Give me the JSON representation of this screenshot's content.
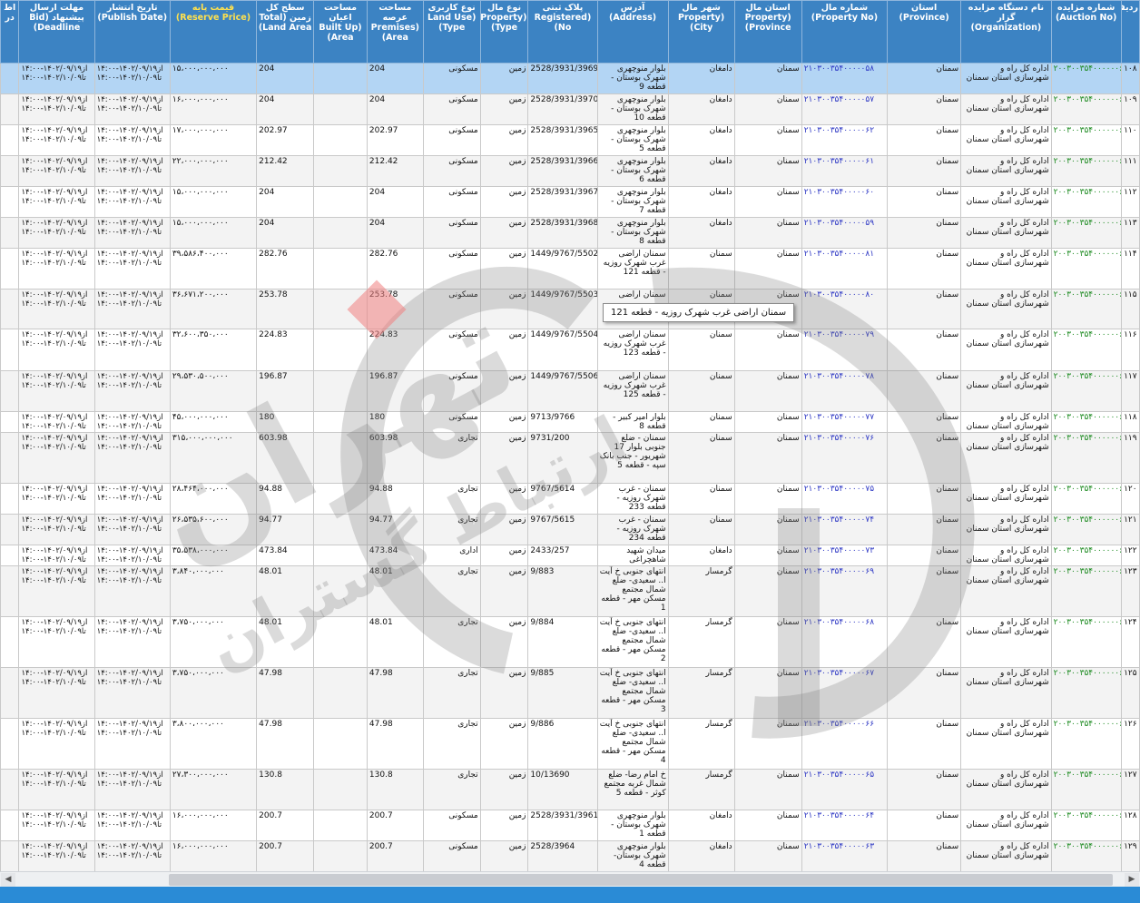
{
  "colors": {
    "header_bg": "#3c83c3",
    "selected_row": "#b3d5f4",
    "link_blue": "#2d37c4",
    "auction_green": "#1c8a20",
    "footer_bar": "#2a8bd6"
  },
  "headers": {
    "row": "ردیف",
    "auction_no": "شماره مزایده (Auction No)",
    "organization": "نام دستگاه مزایده گزار (Organization)",
    "province": "استان (Province)",
    "property_no": "شماره مال (Property No)",
    "property_province": "استان مال (Property Province)",
    "property_city": "شهر مال (Property City)",
    "address": "آدرس (Address)",
    "registered_no": "پلاک ثبتی (Registered No)",
    "property_type": "نوع مال (Property Type)",
    "land_use": "نوع کاربری (Land Use Type)",
    "premises_area": "مساحت عرصه (Premises Area)",
    "built_up_area": "مساحت اعیان (Built Up Area)",
    "total_land": "سطح کل زمین (Total Land Area)",
    "reserve_price": "قیمت پایه (Reserve Price)",
    "publish_date": "تاریخ انتشار (Publish Date)",
    "deadline": "مهلت ارسال پیشنهاد (Bid Deadline)",
    "extra": "اط در"
  },
  "rows": [
    {
      "row": "۱۰۸",
      "auction": "۲۰۰۳۰۰۳۵۴۰۰۰۰۰۰۶",
      "org": "اداره کل راه و شهرسازی استان سمنان",
      "province": "سمنان",
      "prop_no": "۲۱۰۳۰۰۳۵۴۰۰۰۰۰۵۸",
      "prop_province": "سمنان",
      "city": "دامغان",
      "address": "بلوار منوچهری شهرک بوستان - قطعه 9",
      "reg": "2528/3931/3969",
      "ptype": "زمین",
      "use": "مسکونی",
      "premises": "204",
      "built": "",
      "total": "204",
      "price": "۱۵،۰۰۰،۰۰۰،۰۰۰",
      "publish": "از۱۴۰۲/۰۹/۱۹-۱۴:۰۰ تا۱۴۰۲/۱۰/۰۹-۱۴:۰۰",
      "deadline": "از۱۴۰۲/۰۹/۱۹-۱۴:۰۰ تا۱۴۰۲/۱۰/۰۹-۱۴:۰۰"
    },
    {
      "row": "۱۰۹",
      "auction": "۲۰۰۳۰۰۳۵۴۰۰۰۰۰۰۶",
      "org": "اداره کل راه و شهرسازی استان سمنان",
      "province": "سمنان",
      "prop_no": "۲۱۰۳۰۰۳۵۴۰۰۰۰۰۵۷",
      "prop_province": "سمنان",
      "city": "دامغان",
      "address": "بلوار منوچهری شهرک بوستان - قطعه 10",
      "reg": "2528/3931/3970",
      "ptype": "زمین",
      "use": "مسکونی",
      "premises": "204",
      "built": "",
      "total": "204",
      "price": "۱۶،۰۰۰،۰۰۰،۰۰۰",
      "publish": "از۱۴۰۲/۰۹/۱۹-۱۴:۰۰ تا۱۴۰۲/۱۰/۰۹-۱۴:۰۰",
      "deadline": "از۱۴۰۲/۰۹/۱۹-۱۴:۰۰ تا۱۴۰۲/۱۰/۰۹-۱۴:۰۰"
    },
    {
      "row": "۱۱۰",
      "auction": "۲۰۰۳۰۰۳۵۴۰۰۰۰۰۰۶",
      "org": "اداره کل راه و شهرسازی استان سمنان",
      "province": "سمنان",
      "prop_no": "۲۱۰۳۰۰۳۵۴۰۰۰۰۰۶۲",
      "prop_province": "سمنان",
      "city": "دامغان",
      "address": "بلوار منوچهری شهرک بوستان - قطعه 5",
      "reg": "2528/3931/3965",
      "ptype": "زمین",
      "use": "مسکونی",
      "premises": "202.97",
      "built": "",
      "total": "202.97",
      "price": "۱۷،۰۰۰،۰۰۰،۰۰۰",
      "publish": "از۱۴۰۲/۰۹/۱۹-۱۴:۰۰ تا۱۴۰۲/۱۰/۰۹-۱۴:۰۰",
      "deadline": "از۱۴۰۲/۰۹/۱۹-۱۴:۰۰ تا۱۴۰۲/۱۰/۰۹-۱۴:۰۰"
    },
    {
      "row": "۱۱۱",
      "auction": "۲۰۰۳۰۰۳۵۴۰۰۰۰۰۰۶",
      "org": "اداره کل راه و شهرسازی استان سمنان",
      "province": "سمنان",
      "prop_no": "۲۱۰۳۰۰۳۵۴۰۰۰۰۰۶۱",
      "prop_province": "سمنان",
      "city": "دامغان",
      "address": "بلوار منوچهری شهرک بوستان - قطعه 6",
      "reg": "2528/3931/3966",
      "ptype": "زمین",
      "use": "مسکونی",
      "premises": "212.42",
      "built": "",
      "total": "212.42",
      "price": "۲۲،۰۰۰،۰۰۰،۰۰۰",
      "publish": "از۱۴۰۲/۰۹/۱۹-۱۴:۰۰ تا۱۴۰۲/۱۰/۰۹-۱۴:۰۰",
      "deadline": "از۱۴۰۲/۰۹/۱۹-۱۴:۰۰ تا۱۴۰۲/۱۰/۰۹-۱۴:۰۰"
    },
    {
      "row": "۱۱۲",
      "auction": "۲۰۰۳۰۰۳۵۴۰۰۰۰۰۰۶",
      "org": "اداره کل راه و شهرسازی استان سمنان",
      "province": "سمنان",
      "prop_no": "۲۱۰۳۰۰۳۵۴۰۰۰۰۰۶۰",
      "prop_province": "سمنان",
      "city": "دامغان",
      "address": "بلوار منوچهری شهرک بوستان - قطعه 7",
      "reg": "2528/3931/3967",
      "ptype": "زمین",
      "use": "مسکونی",
      "premises": "204",
      "built": "",
      "total": "204",
      "price": "۱۵،۰۰۰،۰۰۰،۰۰۰",
      "publish": "از۱۴۰۲/۰۹/۱۹-۱۴:۰۰ تا۱۴۰۲/۱۰/۰۹-۱۴:۰۰",
      "deadline": "از۱۴۰۲/۰۹/۱۹-۱۴:۰۰ تا۱۴۰۲/۱۰/۰۹-۱۴:۰۰"
    },
    {
      "row": "۱۱۳",
      "auction": "۲۰۰۳۰۰۳۵۴۰۰۰۰۰۰۶",
      "org": "اداره کل راه و شهرسازی استان سمنان",
      "province": "سمنان",
      "prop_no": "۲۱۰۳۰۰۳۵۴۰۰۰۰۰۵۹",
      "prop_province": "سمنان",
      "city": "دامغان",
      "address": "بلوار منوچهری شهرک بوستان - قطعه 8",
      "reg": "2528/3931/3968",
      "ptype": "زمین",
      "use": "مسکونی",
      "premises": "204",
      "built": "",
      "total": "204",
      "price": "۱۵،۰۰۰،۰۰۰،۰۰۰",
      "publish": "از۱۴۰۲/۰۹/۱۹-۱۴:۰۰ تا۱۴۰۲/۱۰/۰۹-۱۴:۰۰",
      "deadline": "از۱۴۰۲/۰۹/۱۹-۱۴:۰۰ تا۱۴۰۲/۱۰/۰۹-۱۴:۰۰"
    },
    {
      "row": "۱۱۴",
      "auction": "۲۰۰۳۰۰۳۵۴۰۰۰۰۰۰۶",
      "org": "اداره کل راه و شهرسازی استان سمنان",
      "province": "سمنان",
      "prop_no": "۲۱۰۳۰۰۳۵۴۰۰۰۰۰۸۱",
      "prop_province": "سمنان",
      "city": "سمنان",
      "address": "سمنان اراضی غرب شهرک روزیه - قطعه 121",
      "reg": "1449/9767/5502",
      "ptype": "زمین",
      "use": "مسکونی",
      "premises": "282.76",
      "built": "",
      "total": "282.76",
      "price": "۳۹،۵۸۶،۴۰۰،۰۰۰",
      "publish": "از۱۴۰۲/۰۹/۱۹-۱۴:۰۰ تا۱۴۰۲/۱۰/۰۹-۱۴:۰۰",
      "deadline": "از۱۴۰۲/۰۹/۱۹-۱۴:۰۰ تا۱۴۰۲/۱۰/۰۹-۱۴:۰۰"
    },
    {
      "row": "۱۱۵",
      "auction": "۲۰۰۳۰۰۳۵۴۰۰۰۰۰۰۶",
      "org": "اداره کل راه و شهرسازی استان سمنان",
      "province": "سمنان",
      "prop_no": "۲۱۰۳۰۰۳۵۴۰۰۰۰۰۸۰",
      "prop_province": "سمنان",
      "city": "سمنان",
      "address": "سمنان اراضی",
      "reg": "1449/9767/5503",
      "ptype": "زمین",
      "use": "مسکونی",
      "premises": "253.78",
      "built": "",
      "total": "253.78",
      "price": "۳۶،۶۷۱،۲۰۰،۰۰۰",
      "publish": "از۱۴۰۲/۰۹/۱۹-۱۴:۰۰ تا۱۴۰۲/۱۰/۰۹-۱۴:۰۰",
      "deadline": "از۱۴۰۲/۰۹/۱۹-۱۴:۰۰ تا۱۴۰۲/۱۰/۰۹-۱۴:۰۰"
    },
    {
      "row": "۱۱۶",
      "auction": "۲۰۰۳۰۰۳۵۴۰۰۰۰۰۰۶",
      "org": "اداره کل راه و شهرسازی استان سمنان",
      "province": "سمنان",
      "prop_no": "۲۱۰۳۰۰۳۵۴۰۰۰۰۰۷۹",
      "prop_province": "سمنان",
      "city": "سمنان",
      "address": "سمنان اراضی غرب شهرک روزیه - قطعه 123",
      "reg": "1449/9767/5504",
      "ptype": "زمین",
      "use": "مسکونی",
      "premises": "224.83",
      "built": "",
      "total": "224.83",
      "price": "۳۲،۶۰۰،۳۵۰،۰۰۰",
      "publish": "از۱۴۰۲/۰۹/۱۹-۱۴:۰۰ تا۱۴۰۲/۱۰/۰۹-۱۴:۰۰",
      "deadline": "از۱۴۰۲/۰۹/۱۹-۱۴:۰۰ تا۱۴۰۲/۱۰/۰۹-۱۴:۰۰"
    },
    {
      "row": "۱۱۷",
      "auction": "۲۰۰۳۰۰۳۵۴۰۰۰۰۰۰۶",
      "org": "اداره کل راه و شهرسازی استان سمنان",
      "province": "سمنان",
      "prop_no": "۲۱۰۳۰۰۳۵۴۰۰۰۰۰۷۸",
      "prop_province": "سمنان",
      "city": "سمنان",
      "address": "سمنان اراضی غرب شهرک روزیه - قطعه 125",
      "reg": "1449/9767/5506",
      "ptype": "زمین",
      "use": "مسکونی",
      "premises": "196.87",
      "built": "",
      "total": "196.87",
      "price": "۲۹،۵۳۰،۵۰۰،۰۰۰",
      "publish": "از۱۴۰۲/۰۹/۱۹-۱۴:۰۰ تا۱۴۰۲/۱۰/۰۹-۱۴:۰۰",
      "deadline": "از۱۴۰۲/۰۹/۱۹-۱۴:۰۰ تا۱۴۰۲/۱۰/۰۹-۱۴:۰۰"
    },
    {
      "row": "۱۱۸",
      "auction": "۲۰۰۳۰۰۳۵۴۰۰۰۰۰۰۶",
      "org": "اداره کل راه و شهرسازی استان سمنان",
      "province": "سمنان",
      "prop_no": "۲۱۰۳۰۰۳۵۴۰۰۰۰۰۷۷",
      "prop_province": "سمنان",
      "city": "سمنان",
      "address": "بلوار امیر کبیر - قطعه 8",
      "reg": "9713/9766",
      "ptype": "زمین",
      "use": "مسکونی",
      "premises": "180",
      "built": "",
      "total": "180",
      "price": "۴۵،۰۰۰،۰۰۰،۰۰۰",
      "publish": "از۱۴۰۲/۰۹/۱۹-۱۴:۰۰ تا۱۴۰۲/۱۰/۰۹-۱۴:۰۰",
      "deadline": "از۱۴۰۲/۰۹/۱۹-۱۴:۰۰ تا۱۴۰۲/۱۰/۰۹-۱۴:۰۰"
    },
    {
      "row": "۱۱۹",
      "auction": "۲۰۰۳۰۰۳۵۴۰۰۰۰۰۰۶",
      "org": "اداره کل راه و شهرسازی استان سمنان",
      "province": "سمنان",
      "prop_no": "۲۱۰۳۰۰۳۵۴۰۰۰۰۰۷۶",
      "prop_province": "سمنان",
      "city": "سمنان",
      "address": "سمنان - ضلع جنوبی بلوار 17 شهریور - جنب بانک سپه - قطعه 5",
      "reg": "9731/200",
      "ptype": "زمین",
      "use": "تجاری",
      "premises": "603.98",
      "built": "",
      "total": "603.98",
      "price": "۳۱۵،۰۰۰،۰۰۰،۰۰۰",
      "publish": "از۱۴۰۲/۰۹/۱۹-۱۴:۰۰ تا۱۴۰۲/۱۰/۰۹-۱۴:۰۰",
      "deadline": "از۱۴۰۲/۰۹/۱۹-۱۴:۰۰ تا۱۴۰۲/۱۰/۰۹-۱۴:۰۰"
    },
    {
      "row": "۱۲۰",
      "auction": "۲۰۰۳۰۰۳۵۴۰۰۰۰۰۰۶",
      "org": "اداره کل راه و شهرسازی استان سمنان",
      "province": "سمنان",
      "prop_no": "۲۱۰۳۰۰۳۵۴۰۰۰۰۰۷۵",
      "prop_province": "سمنان",
      "city": "سمنان",
      "address": "سمنان - غرب شهرک روزیه - قطعه 233",
      "reg": "9767/5614",
      "ptype": "زمین",
      "use": "تجاری",
      "premises": "94.88",
      "built": "",
      "total": "94.88",
      "price": "۲۸،۴۶۴،۰۰۰،۰۰۰",
      "publish": "از۱۴۰۲/۰۹/۱۹-۱۴:۰۰ تا۱۴۰۲/۱۰/۰۹-۱۴:۰۰",
      "deadline": "از۱۴۰۲/۰۹/۱۹-۱۴:۰۰ تا۱۴۰۲/۱۰/۰۹-۱۴:۰۰"
    },
    {
      "row": "۱۲۱",
      "auction": "۲۰۰۳۰۰۳۵۴۰۰۰۰۰۰۶",
      "org": "اداره کل راه و شهرسازی استان سمنان",
      "province": "سمنان",
      "prop_no": "۲۱۰۳۰۰۳۵۴۰۰۰۰۰۷۴",
      "prop_province": "سمنان",
      "city": "سمنان",
      "address": "سمنان - غرب شهرک روزیه - قطعه 234",
      "reg": "9767/5615",
      "ptype": "زمین",
      "use": "تجاری",
      "premises": "94.77",
      "built": "",
      "total": "94.77",
      "price": "۲۶،۵۳۵،۶۰۰،۰۰۰",
      "publish": "از۱۴۰۲/۰۹/۱۹-۱۴:۰۰ تا۱۴۰۲/۱۰/۰۹-۱۴:۰۰",
      "deadline": "از۱۴۰۲/۰۹/۱۹-۱۴:۰۰ تا۱۴۰۲/۱۰/۰۹-۱۴:۰۰"
    },
    {
      "row": "۱۲۲",
      "auction": "۲۰۰۳۰۰۳۵۴۰۰۰۰۰۰۶",
      "org": "اداره کل راه و شهرسازی استان سمنان",
      "province": "سمنان",
      "prop_no": "۲۱۰۳۰۰۳۵۴۰۰۰۰۰۷۳",
      "prop_province": "سمنان",
      "city": "دامغان",
      "address": "میدان شهید شاهچراغی",
      "reg": "2433/257",
      "ptype": "زمین",
      "use": "اداری",
      "premises": "473.84",
      "built": "",
      "total": "473.84",
      "price": "۳۵،۵۳۸،۰۰۰،۰۰۰",
      "publish": "از۱۴۰۲/۰۹/۱۹-۱۴:۰۰ تا۱۴۰۲/۱۰/۰۹-۱۴:۰۰",
      "deadline": "از۱۴۰۲/۰۹/۱۹-۱۴:۰۰ تا۱۴۰۲/۱۰/۰۹-۱۴:۰۰"
    },
    {
      "row": "۱۲۳",
      "auction": "۲۰۰۳۰۰۳۵۴۰۰۰۰۰۰۶",
      "org": "اداره کل راه و شهرسازی استان سمنان",
      "province": "سمنان",
      "prop_no": "۲۱۰۳۰۰۳۵۴۰۰۰۰۰۶۹",
      "prop_province": "سمنان",
      "city": "گرمسار",
      "address": "انتهای جنوبی خ آیت ا.. سعیدی- ضلع شمال مجتمع مسکن مهر - قطعه 1",
      "reg": "9/883",
      "ptype": "زمین",
      "use": "تجاری",
      "premises": "48.01",
      "built": "",
      "total": "48.01",
      "price": "۳،۸۴۰،۰۰۰،۰۰۰",
      "publish": "از۱۴۰۲/۰۹/۱۹-۱۴:۰۰ تا۱۴۰۲/۱۰/۰۹-۱۴:۰۰",
      "deadline": "از۱۴۰۲/۰۹/۱۹-۱۴:۰۰ تا۱۴۰۲/۱۰/۰۹-۱۴:۰۰"
    },
    {
      "row": "۱۲۴",
      "auction": "۲۰۰۳۰۰۳۵۴۰۰۰۰۰۰۶",
      "org": "اداره کل راه و شهرسازی استان سمنان",
      "province": "سمنان",
      "prop_no": "۲۱۰۳۰۰۳۵۴۰۰۰۰۰۶۸",
      "prop_province": "سمنان",
      "city": "گرمسار",
      "address": "انتهای جنوبی خ آیت ا.. سعیدی- ضلع شمال مجتمع مسکن مهر - قطعه 2",
      "reg": "9/884",
      "ptype": "زمین",
      "use": "تجاری",
      "premises": "48.01",
      "built": "",
      "total": "48.01",
      "price": "۳،۷۵۰،۰۰۰،۰۰۰",
      "publish": "از۱۴۰۲/۰۹/۱۹-۱۴:۰۰ تا۱۴۰۲/۱۰/۰۹-۱۴:۰۰",
      "deadline": "از۱۴۰۲/۰۹/۱۹-۱۴:۰۰ تا۱۴۰۲/۱۰/۰۹-۱۴:۰۰"
    },
    {
      "row": "۱۲۵",
      "auction": "۲۰۰۳۰۰۳۵۴۰۰۰۰۰۰۶",
      "org": "اداره کل راه و شهرسازی استان سمنان",
      "province": "سمنان",
      "prop_no": "۲۱۰۳۰۰۳۵۴۰۰۰۰۰۶۷",
      "prop_province": "سمنان",
      "city": "گرمسار",
      "address": "انتهای جنوبی خ آیت ا.. سعیدی- ضلع شمال مجتمع مسکن مهر - قطعه 3",
      "reg": "9/885",
      "ptype": "زمین",
      "use": "تجاری",
      "premises": "47.98",
      "built": "",
      "total": "47.98",
      "price": "۳،۷۵۰،۰۰۰،۰۰۰",
      "publish": "از۱۴۰۲/۰۹/۱۹-۱۴:۰۰ تا۱۴۰۲/۱۰/۰۹-۱۴:۰۰",
      "deadline": "از۱۴۰۲/۰۹/۱۹-۱۴:۰۰ تا۱۴۰۲/۱۰/۰۹-۱۴:۰۰"
    },
    {
      "row": "۱۲۶",
      "auction": "۲۰۰۳۰۰۳۵۴۰۰۰۰۰۰۶",
      "org": "اداره کل راه و شهرسازی استان سمنان",
      "province": "سمنان",
      "prop_no": "۲۱۰۳۰۰۳۵۴۰۰۰۰۰۶۶",
      "prop_province": "سمنان",
      "city": "گرمسار",
      "address": "انتهای جنوبی خ آیت ا.. سعیدی- ضلع شمال مجتمع مسکن مهر - قطعه 4",
      "reg": "9/886",
      "ptype": "زمین",
      "use": "تجاری",
      "premises": "47.98",
      "built": "",
      "total": "47.98",
      "price": "۳،۸۰۰،۰۰۰،۰۰۰",
      "publish": "از۱۴۰۲/۰۹/۱۹-۱۴:۰۰ تا۱۴۰۲/۱۰/۰۹-۱۴:۰۰",
      "deadline": "از۱۴۰۲/۰۹/۱۹-۱۴:۰۰ تا۱۴۰۲/۱۰/۰۹-۱۴:۰۰"
    },
    {
      "row": "۱۲۷",
      "auction": "۲۰۰۳۰۰۳۵۴۰۰۰۰۰۰۶",
      "org": "اداره کل راه و شهرسازی استان سمنان",
      "province": "سمنان",
      "prop_no": "۲۱۰۳۰۰۳۵۴۰۰۰۰۰۶۵",
      "prop_province": "سمنان",
      "city": "گرمسار",
      "address": "خ امام رضا- ضلع شمال غربه مجتمع کوثر - قطعه 5",
      "reg": "10/13690",
      "ptype": "زمین",
      "use": "تجاری",
      "premises": "130.8",
      "built": "",
      "total": "130.8",
      "price": "۲۷،۳۰۰،۰۰۰،۰۰۰",
      "publish": "از۱۴۰۲/۰۹/۱۹-۱۴:۰۰ تا۱۴۰۲/۱۰/۰۹-۱۴:۰۰",
      "deadline": "از۱۴۰۲/۰۹/۱۹-۱۴:۰۰ تا۱۴۰۲/۱۰/۰۹-۱۴:۰۰"
    },
    {
      "row": "۱۲۸",
      "auction": "۲۰۰۳۰۰۳۵۴۰۰۰۰۰۰۶",
      "org": "اداره کل راه و شهرسازی استان سمنان",
      "province": "سمنان",
      "prop_no": "۲۱۰۳۰۰۳۵۴۰۰۰۰۰۶۴",
      "prop_province": "سمنان",
      "city": "دامغان",
      "address": "بلوار منوچهری شهرک بوستان - قطعه 1",
      "reg": "2528/3931/3961",
      "ptype": "زمین",
      "use": "مسکونی",
      "premises": "200.7",
      "built": "",
      "total": "200.7",
      "price": "۱۶،۰۰۰،۰۰۰،۰۰۰",
      "publish": "از۱۴۰۲/۰۹/۱۹-۱۴:۰۰ تا۱۴۰۲/۱۰/۰۹-۱۴:۰۰",
      "deadline": "از۱۴۰۲/۰۹/۱۹-۱۴:۰۰ تا۱۴۰۲/۱۰/۰۹-۱۴:۰۰"
    },
    {
      "row": "۱۲۹",
      "auction": "۲۰۰۳۰۰۳۵۴۰۰۰۰۰۰۶",
      "org": "اداره کل راه و شهرسازی استان سمنان",
      "province": "سمنان",
      "prop_no": "۲۱۰۳۰۰۳۵۴۰۰۰۰۰۶۳",
      "prop_province": "سمنان",
      "city": "دامغان",
      "address": "بلوار منوچهری شهرک بوستان- قطعه 4",
      "reg": "2528/3964",
      "ptype": "زمین",
      "use": "مسکونی",
      "premises": "200.7",
      "built": "",
      "total": "200.7",
      "price": "۱۶،۰۰۰،۰۰۰،۰۰۰",
      "publish": "از۱۴۰۲/۰۹/۱۹-۱۴:۰۰ تا۱۴۰۲/۱۰/۰۹-۱۴:۰۰",
      "deadline": "از۱۴۰۲/۰۹/۱۹-۱۴:۰۰ تا۱۴۰۲/۱۰/۰۹-۱۴:۰۰"
    }
  ],
  "tooltip": "سمنان اراضی غرب شهرک روزیه - قطعه 121",
  "watermark": {
    "line1": "تهران",
    "line2": "ارتباط گستران"
  },
  "scrollbar": {
    "left_arrow": "◀",
    "right_arrow": "▶"
  }
}
